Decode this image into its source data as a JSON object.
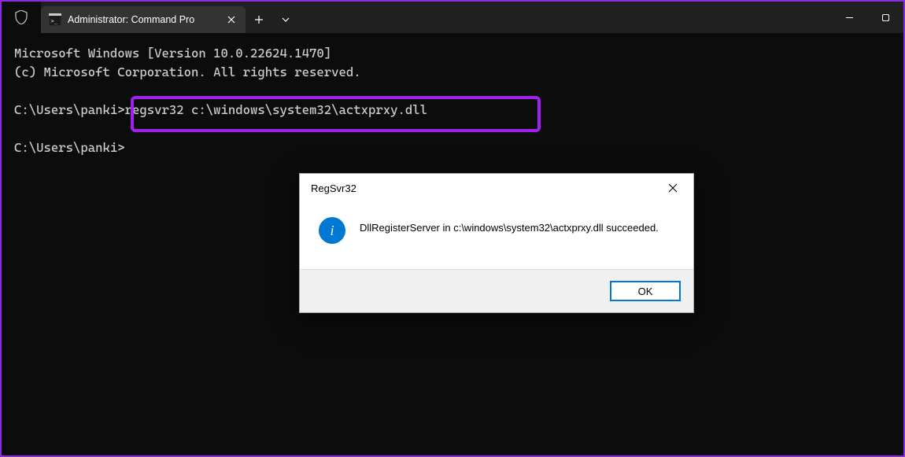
{
  "titlebar": {
    "tab_title": "Administrator: Command Pro"
  },
  "terminal": {
    "line1": "Microsoft Windows [Version 10.0.22624.1470]",
    "line2": "(c) Microsoft Corporation. All rights reserved.",
    "prompt1_path": "C:\\Users\\panki>",
    "command": "regsvr32 c:\\windows\\system32\\actxprxy.dll",
    "prompt2_path": "C:\\Users\\panki>"
  },
  "dialog": {
    "title": "RegSvr32",
    "message": "DllRegisterServer in c:\\windows\\system32\\actxprxy.dll succeeded.",
    "ok_label": "OK"
  }
}
